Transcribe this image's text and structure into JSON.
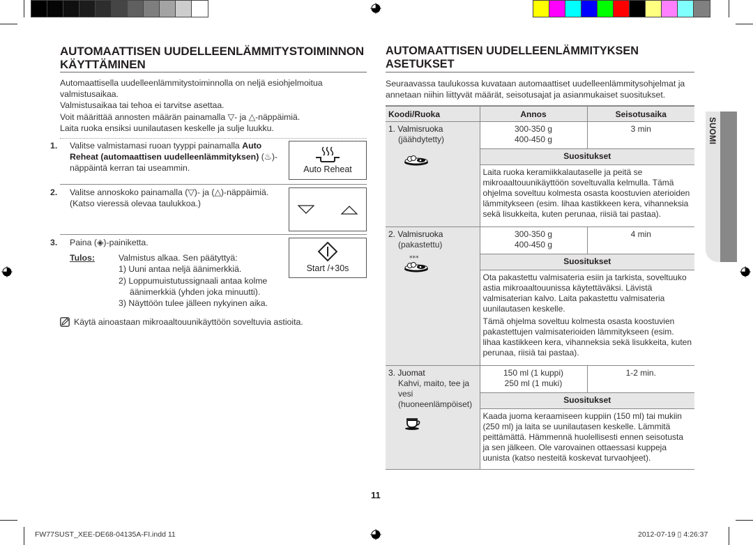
{
  "print_marks": {
    "gray_swatches": [
      "#000000",
      "#050505",
      "#0f0f0f",
      "#1c1c1c",
      "#2e2e2e",
      "#454545",
      "#5f5f5f",
      "#7e7e7e",
      "#a3a3a3",
      "#cdcdcd",
      "#ffffff"
    ],
    "color_swatches": [
      "#ffff00",
      "#ff00ff",
      "#00ffff",
      "#0000ff",
      "#00ff00",
      "#ff0000",
      "#000000",
      "#ffff80",
      "#ff80ff",
      "#80ffff",
      "#808080"
    ]
  },
  "left": {
    "title_line1": "AUTOMAATTISEN UUDELLEENLÄMMITYSTOIMINNON",
    "title_line2": "KÄYTTÄMINEN",
    "intro": [
      "Automaattisella uudelleenlämmitystoiminnolla on neljä esiohjelmoitua valmistusaikaa.",
      "Valmistusaikaa tai tehoa ei tarvitse asettaa.",
      "Voit määrittää annosten määrän painamalla ▽- ja △-näppäimiä.",
      "Laita ruoka ensiksi uunilautasen keskelle ja sulje luukku."
    ],
    "steps": [
      {
        "num": "1.",
        "text_pre": "Valitse valmistamasi ruoan tyyppi painamalla ",
        "text_bold": "Auto Reheat (automaattisen uudelleenlämmityksen)",
        "text_post": " (♨)-näppäintä kerran tai useammin.",
        "panel_label": "Auto Reheat",
        "panel_icon": "auto-reheat-icon"
      },
      {
        "num": "2.",
        "text": "Valitse annoskoko painamalla (▽)- ja (△)-näppäimiä. (Katso vieressä olevaa taulukkoa.)",
        "panel_icons": [
          "down-arrow-icon",
          "up-arrow-icon"
        ]
      },
      {
        "num": "3.",
        "text": "Paina (◈)-painiketta.",
        "panel_label": "Start /+30s",
        "panel_icon": "start-icon",
        "result_label": "Tulos:",
        "result_text": "Valmistus alkaa. Sen päätyttyä:",
        "result_items": [
          "1)  Uuni antaa neljä äänimerkkiä.",
          "2)  Loppumuistutussignaali antaa kolme äänimerkkiä (yhden joka minuutti).",
          "3)  Näyttöön tulee jälleen nykyinen aika."
        ]
      }
    ],
    "note": "Käytä ainoastaan mikroaaltouunikäyttöön soveltuvia astioita."
  },
  "right": {
    "title": "AUTOMAATTISEN UUDELLEENLÄMMITYKSEN ASETUKSET",
    "description": "Seuraavassa taulukossa kuvataan automaattiset uudelleenlämmitysohjelmat ja annetaan niihin liittyvät määrät, seisotusajat ja asianmukaiset suositukset.",
    "table": {
      "headers": [
        "Koodi/Ruoka",
        "Annos",
        "Seisotusaika"
      ],
      "suggestions_header": "Suositukset",
      "rows": [
        {
          "code": "1. Valmisruoka",
          "sub": "(jäähdytetty)",
          "sub2": "",
          "icon": "plated-meal-icon",
          "amounts": [
            "300-350 g",
            "400-450 g"
          ],
          "time": "3 min",
          "suggestions": [
            "Laita ruoka keramiikkalautaselle ja peitä se mikroaaltouunikäyttöön soveltuvalla kelmulla. Tämä ohjelma soveltuu kolmesta osasta koostuvien aterioiden lämmitykseen (esim. lihaa kastikkeen kera, vihanneksia sekä lisukkeita, kuten perunaa, riisiä tai pastaa)."
          ]
        },
        {
          "code": "2. Valmisruoka",
          "sub": "(pakastettu)",
          "sub2": "",
          "icon": "frozen-meal-icon",
          "amounts": [
            "300-350 g",
            "400-450 g"
          ],
          "time": "4 min",
          "suggestions": [
            "Ota pakastettu valmisateria esiin ja tarkista, soveltuuko astia mikroaaltouunissa käytettäväksi. Lävistä valmisaterian kalvo. Laita pakastettu valmisateria uunilautasen keskelle.",
            "Tämä ohjelma soveltuu kolmesta osasta koostuvien pakastettujen valmisaterioiden lämmitykseen (esim. lihaa kastikkeen kera, vihanneksia sekä lisukkeita, kuten perunaa, riisiä tai pastaa)."
          ]
        },
        {
          "code": "3. Juomat",
          "sub": "Kahvi, maito, tee ja vesi",
          "sub2": "(huoneenlämpöiset)",
          "icon": "coffee-cup-icon",
          "amounts": [
            "150 ml (1 kuppi)",
            "250 ml (1 muki)"
          ],
          "time": "1-2 min.",
          "suggestions": [
            "Kaada juoma keraamiseen kuppiin (150 ml) tai mukiin (250 ml) ja laita se uunilautasen keskelle. Lämmitä peittämättä. Hämmennä huolellisesti ennen seisotusta ja sen jälkeen. Ole varovainen ottaessasi kuppeja uunista (katso nesteitä koskevat turvaohjeet)."
          ]
        }
      ]
    }
  },
  "side_tab": {
    "label": "SUOMI"
  },
  "page_number": "11",
  "footer": {
    "file": "FW77SUST_XEE-DE68-04135A-FI.indd   11",
    "timestamp": "2012-07-19   ▯ 4:26:37"
  }
}
